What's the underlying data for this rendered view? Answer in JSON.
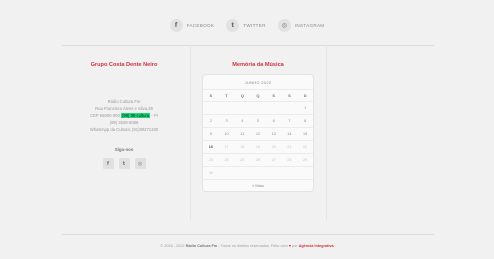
{
  "social": [
    {
      "icon": "facebook-icon",
      "glyph": "f",
      "label": "FACEBOOK"
    },
    {
      "icon": "twitter-icon",
      "glyph": "t",
      "label": "TWITTER"
    },
    {
      "icon": "instagram-icon",
      "glyph": "◎",
      "label": "INSTAGRAM"
    }
  ],
  "left": {
    "title": "Grupo Costa Dente Neiro",
    "address": {
      "line1": "Rádio Cultura Fm",
      "line2": "Rua Francisco Alves e Silva,29",
      "line3_prefix": "CEP 65000-000 ",
      "line3_highlight": "(99) 98-cultura",
      "line3_suffix": " - PI",
      "line4": "(99) 3529-5089",
      "line5": "WhatsApp da Cultura: (91)98271330"
    },
    "follow_title": "Siga-nos",
    "follow_icons": [
      {
        "icon": "facebook-icon",
        "glyph": "f"
      },
      {
        "icon": "twitter-icon",
        "glyph": "t"
      },
      {
        "icon": "instagram-icon",
        "glyph": "◎"
      }
    ]
  },
  "calendar": {
    "title": "Memória da Música",
    "caption": "JUNHO 2022",
    "weekdays": [
      "S",
      "T",
      "Q",
      "Q",
      "S",
      "S",
      "D"
    ],
    "rows": [
      {
        "days": [
          "",
          "",
          "",
          "",
          "",
          "",
          "1"
        ],
        "faded": false
      },
      {
        "days": [
          "2",
          "3",
          "4",
          "5",
          "6",
          "7",
          "8"
        ],
        "faded": false
      },
      {
        "days": [
          "9",
          "10",
          "11",
          "12",
          "13",
          "14",
          "15"
        ],
        "faded": false
      },
      {
        "days": [
          "16",
          "17",
          "18",
          "19",
          "20",
          "21",
          "22"
        ],
        "faded": true
      },
      {
        "days": [
          "23",
          "24",
          "25",
          "26",
          "27",
          "28",
          "29"
        ],
        "faded": true
      },
      {
        "days": [
          "30",
          "",
          "",
          "",
          "",
          "",
          ""
        ],
        "faded": true
      }
    ],
    "today": "16",
    "prev_label": "« Maio"
  },
  "footer": {
    "prefix": "© 2016 - 2022 ",
    "brand": "Rádio Cultura Fm",
    "middle": " - Todos os direitos reservados. Feito com ",
    "heart": "♥",
    "suffix": " por ",
    "author": "Agência Integrativa"
  },
  "colors": {
    "accent": "#d3303f",
    "highlight": "#19d97a",
    "background": "#f1f1f1"
  }
}
